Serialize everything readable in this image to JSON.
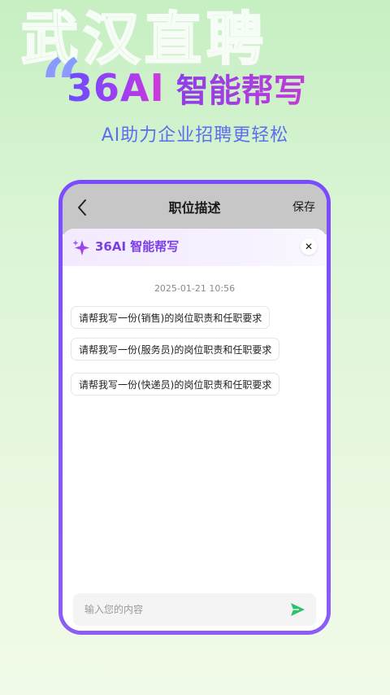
{
  "promo": {
    "watermark": "武汉直聘",
    "brand": "36AI",
    "title": "智能帮写",
    "subtitle": "AI助力企业招聘更轻松"
  },
  "header": {
    "title": "职位描述",
    "save_label": "保存"
  },
  "panel": {
    "brand": "36AI 智能帮写",
    "close_symbol": "✕",
    "timestamp": "2025-01-21 10:56",
    "suggestions": [
      "请帮我写一份(销售)的岗位职责和任职要求",
      "请帮我写一份(服务员)的岗位职责和任职要求",
      "请帮我写一份(快递员)的岗位职责和任职要求"
    ]
  },
  "input": {
    "placeholder": "输入您的内容",
    "value": ""
  },
  "colors": {
    "accent_purple": "#7b4cff",
    "send_green": "#2fbf6a"
  },
  "icons": {
    "back": "chevron-left-icon",
    "sparkle": "sparkle-icon",
    "close": "close-icon",
    "send": "send-icon"
  }
}
